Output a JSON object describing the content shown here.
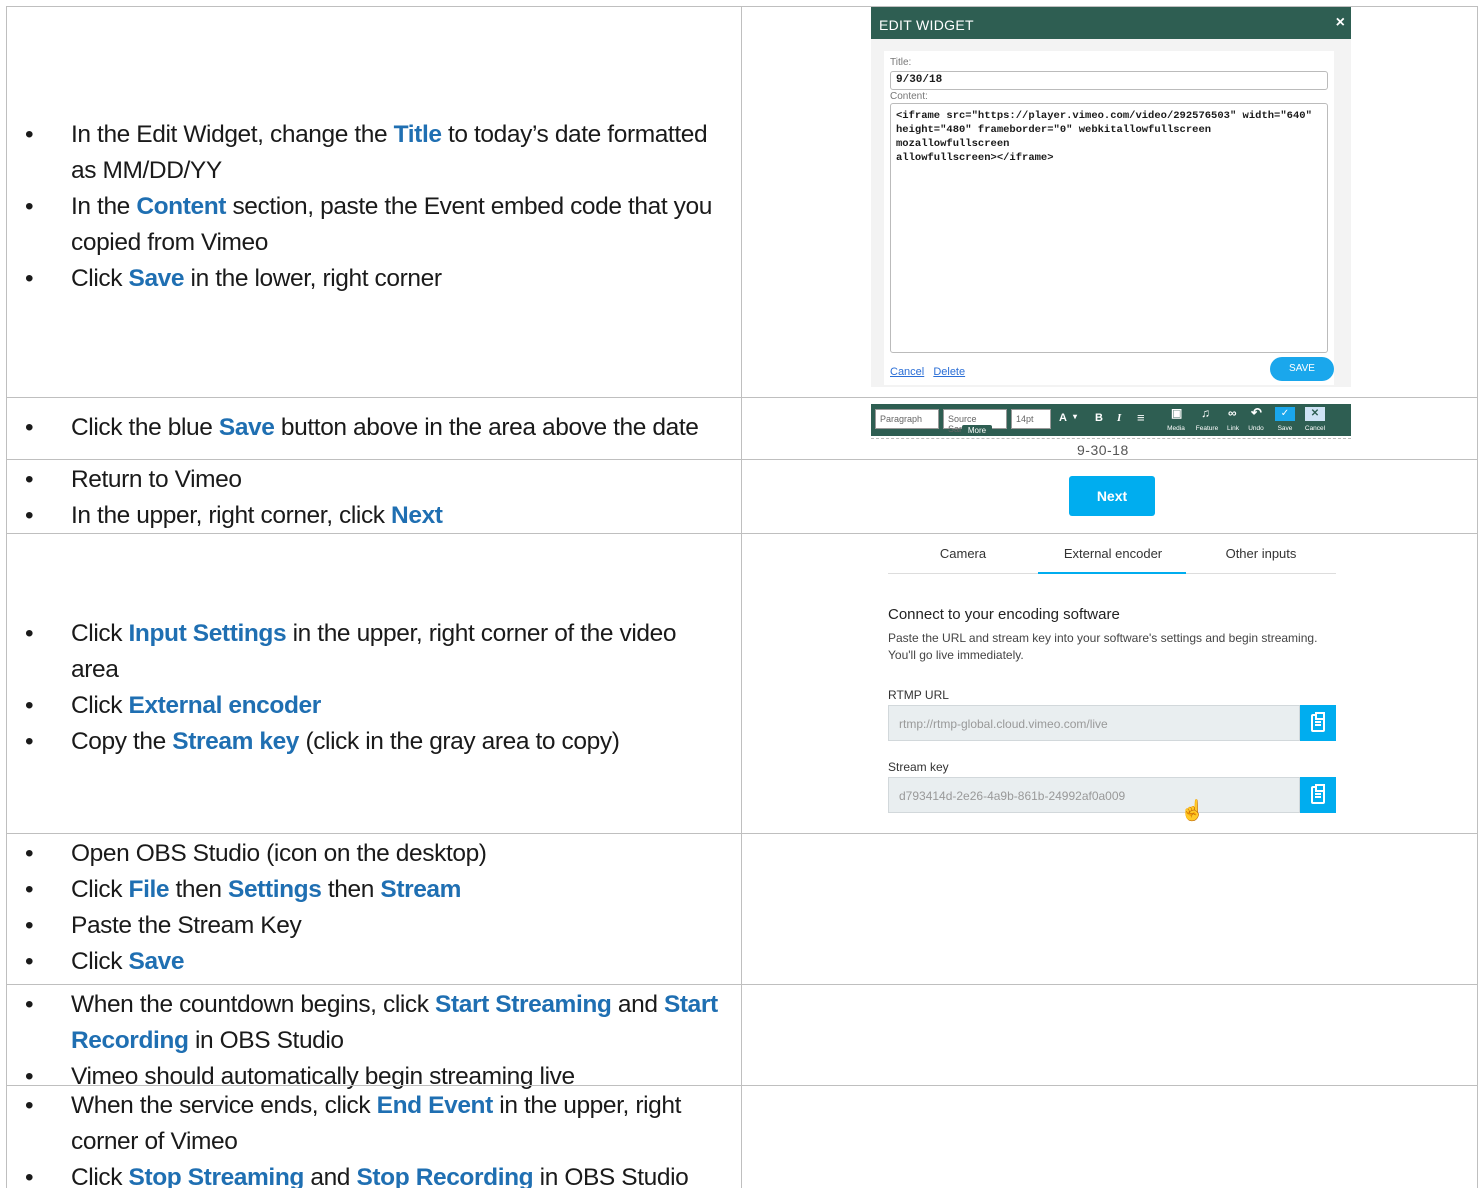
{
  "rows": [
    {
      "bullets": [
        [
          {
            "t": "In the Edit Widget, change the "
          },
          {
            "t": "Title",
            "h": true
          },
          {
            "t": " to today’s date formatted as MM/DD/YY"
          }
        ],
        [
          {
            "t": "In the "
          },
          {
            "t": "Content",
            "h": true
          },
          {
            "t": " section, paste the Event embed code that you copied from Vimeo"
          }
        ],
        [
          {
            "t": "Click "
          },
          {
            "t": "Save",
            "h": true
          },
          {
            "t": " in the lower, right corner"
          }
        ]
      ]
    },
    {
      "bullets": [
        [
          {
            "t": "Click the blue "
          },
          {
            "t": "Save",
            "h": true
          },
          {
            "t": " button above in the area above the date"
          }
        ]
      ]
    },
    {
      "bullets": [
        [
          {
            "t": "Return to Vimeo"
          }
        ],
        [
          {
            "t": "In the upper, right corner, click "
          },
          {
            "t": "Next",
            "h": true
          }
        ]
      ]
    },
    {
      "bullets": [
        [
          {
            "t": "Click "
          },
          {
            "t": "Input Settings",
            "h": true
          },
          {
            "t": " in the upper, right corner of the video area"
          }
        ],
        [
          {
            "t": "Click "
          },
          {
            "t": "External encoder",
            "h": true
          }
        ],
        [
          {
            "t": "Copy the "
          },
          {
            "t": "Stream key",
            "h": true
          },
          {
            "t": " (click in the gray area to copy)"
          }
        ]
      ]
    },
    {
      "bullets": [
        [
          {
            "t": "Open OBS Studio (icon on the desktop)"
          }
        ],
        [
          {
            "t": "Click "
          },
          {
            "t": "File",
            "h": true
          },
          {
            "t": " then "
          },
          {
            "t": "Settings",
            "h": true
          },
          {
            "t": " then "
          },
          {
            "t": "Stream",
            "h": true
          }
        ],
        [
          {
            "t": "Paste the Stream Key"
          }
        ],
        [
          {
            "t": "Click "
          },
          {
            "t": "Save",
            "h": true
          }
        ]
      ]
    },
    {
      "bullets": [
        [
          {
            "t": "When the countdown begins, click "
          },
          {
            "t": "Start Streaming",
            "h": true
          },
          {
            "t": " and "
          },
          {
            "t": "Start Recording",
            "h": true
          },
          {
            "t": " in OBS Studio"
          }
        ],
        [
          {
            "t": "Vimeo should automatically begin streaming live"
          }
        ]
      ]
    },
    {
      "bullets": [
        [
          {
            "t": "When the service ends, click "
          },
          {
            "t": "End Event",
            "h": true
          },
          {
            "t": " in the upper, right corner of Vimeo"
          }
        ],
        [
          {
            "t": "Click "
          },
          {
            "t": "Stop Streaming",
            "h": true
          },
          {
            "t": " and "
          },
          {
            "t": "Stop Recording",
            "h": true
          },
          {
            "t": " in OBS Studio"
          }
        ]
      ]
    }
  ],
  "bullet_glyph": "•",
  "widget": {
    "header": "EDIT WIDGET",
    "close": "×",
    "title_label": "Title:",
    "title_value": "9/30/18",
    "content_label": "Content:",
    "content_lines": [
      "<iframe src=\"https://player.vimeo.com/video/292576503\" width=\"640\"",
      "height=\"480\" frameborder=\"0\" webkitallowfullscreen mozallowfullscreen",
      "allowfullscreen></iframe>"
    ],
    "cancel": "Cancel",
    "delete": "Delete",
    "save": "SAVE"
  },
  "toolbar": {
    "paragraph": "Paragraph",
    "font": "Source San...",
    "size": "14pt",
    "font_color": "A",
    "bold": "B",
    "italic": "I",
    "align": "≡",
    "more": "More",
    "media": "Media",
    "feature": "Feature",
    "link": "Link",
    "undo": "Undo",
    "save": "Save",
    "cancel": "Cancel",
    "date": "9-30-18"
  },
  "next_button": "Next",
  "encoder": {
    "tabs": [
      "Camera",
      "External encoder",
      "Other inputs"
    ],
    "heading": "Connect to your encoding software",
    "description": "Paste the URL and stream key into your software's settings and begin streaming. You'll go live immediately.",
    "rtmp_label": "RTMP URL",
    "rtmp_value": "rtmp://rtmp-global.cloud.vimeo.com/live",
    "key_label": "Stream key",
    "key_value": "d793414d-2e26-4a9b-861b-24992af0a009"
  },
  "colors": {
    "highlight": "#1f6fb2",
    "widget_green": "#2e5e52",
    "vimeo_blue": "#00adef"
  }
}
